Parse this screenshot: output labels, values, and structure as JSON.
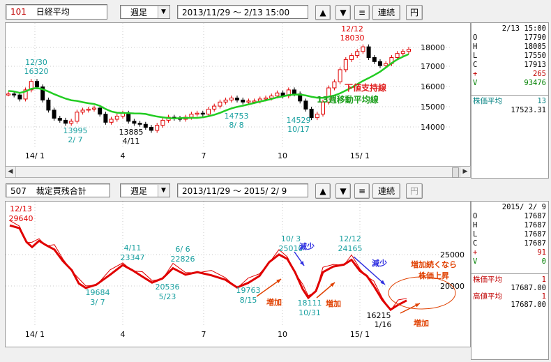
{
  "top": {
    "code": "101",
    "name": "日経平均",
    "period": "週足",
    "range": "2013/11/29 ～  2/13 15:00",
    "buttons": {
      "up": "▲",
      "down": "▼",
      "menu": "≡",
      "cont": "連続",
      "yen": "円"
    },
    "info": {
      "date": "2/13 15:00",
      "rows": [
        {
          "k": "O",
          "v": "17790"
        },
        {
          "k": "H",
          "v": "18005"
        },
        {
          "k": "L",
          "v": "17550"
        },
        {
          "k": "C",
          "v": "17913"
        },
        {
          "k": "+",
          "v": "265"
        },
        {
          "k": "V",
          "v": "93476"
        }
      ],
      "ma_label": "株価平均",
      "ma_period": "13",
      "ma_value": "17523.31"
    },
    "yticks": [
      "18000",
      "17000",
      "16000",
      "15000",
      "14000"
    ],
    "xticks": [
      "14/ 1",
      "4",
      "7",
      "10",
      "15/ 1"
    ],
    "annotations": {
      "a1_date": "12/30",
      "a1_val": "16320",
      "a2_val": "13995",
      "a2_date": "2/ 7",
      "a3_val": "13885",
      "a3_date": "4/11",
      "a4_val": "14753",
      "a4_date": "8/ 8",
      "a5_val": "14529",
      "a5_date": "10/17",
      "a6_date": "12/12",
      "a6_val": "18030",
      "support": "下値支持線",
      "ma_line": "13週移動平均線"
    }
  },
  "bottom": {
    "code": "507",
    "name": "裁定買残合計",
    "period": "週足",
    "range": "2013/11/29 ～  2015/ 2/ 9",
    "buttons": {
      "up": "▲",
      "down": "▼",
      "menu": "≡",
      "cont": "連続",
      "yen": "円"
    },
    "info": {
      "date": "2015/ 2/ 9",
      "rows": [
        {
          "k": "O",
          "v": "17687"
        },
        {
          "k": "H",
          "v": "17687"
        },
        {
          "k": "L",
          "v": "17687"
        },
        {
          "k": "C",
          "v": "17687"
        },
        {
          "k": "+",
          "v": "91"
        },
        {
          "k": "V",
          "v": "0"
        }
      ],
      "ma_label": "株価平均",
      "ma_period": "1",
      "ma_value": "17687.00",
      "hi_label": "高値平均",
      "hi_period": "1",
      "hi_value": "17687.00"
    },
    "yticks": [
      "25000",
      "20000"
    ],
    "xticks": [
      "14/ 1",
      "4",
      "7",
      "10",
      "15/ 1"
    ],
    "annotations": {
      "b1_date": "12/13",
      "b1_val": "29640",
      "b2_date": "4/11",
      "b2_val": "23347",
      "b3_date": "6/ 6",
      "b3_val": "22826",
      "b4_val": "19684",
      "b4_date": "3/ 7",
      "b5_val": "20536",
      "b5_date": "5/23",
      "b6_val": "19763",
      "b6_date": "8/15",
      "b7_date": "10/ 3",
      "b7_val": "25010",
      "b8_val": "18111",
      "b8_date": "10/31",
      "b9_date": "12/12",
      "b9_val": "24165",
      "b10_val": "16215",
      "b10_date": "1/16",
      "dec1": "減少",
      "dec2": "減少",
      "inc1": "増加",
      "inc2": "増加",
      "inc3": "増加",
      "note1": "増加続くなら",
      "note2": "株価上昇"
    }
  },
  "chart_data": [
    {
      "type": "line",
      "title": "日経平均 週足",
      "x": [
        "2013/12/30",
        "2014/2/7",
        "2014/4/11",
        "2014/8/8",
        "2014/10/17",
        "2014/12/12",
        "2015/2/13"
      ],
      "series": [
        {
          "name": "日経平均",
          "values": [
            16320,
            13995,
            13885,
            14753,
            14529,
            18030,
            17913
          ]
        },
        {
          "name": "13週移動平均線",
          "values": [
            15300,
            15350,
            14900,
            14750,
            15450,
            16900,
            17523.31
          ]
        }
      ],
      "ylim": [
        13700,
        18400
      ]
    },
    {
      "type": "line",
      "title": "裁定買残合計 週足",
      "x": [
        "2013/12/13",
        "2014/3/7",
        "2014/4/11",
        "2014/5/23",
        "2014/6/6",
        "2014/8/15",
        "2014/10/3",
        "2014/10/31",
        "2014/12/12",
        "2015/1/16",
        "2015/2/9"
      ],
      "series": [
        {
          "name": "裁定買残合計",
          "values": [
            29640,
            19684,
            23347,
            20536,
            22826,
            19763,
            25010,
            18111,
            24165,
            16215,
            17687
          ]
        }
      ],
      "ylim": [
        15000,
        31000
      ]
    }
  ]
}
